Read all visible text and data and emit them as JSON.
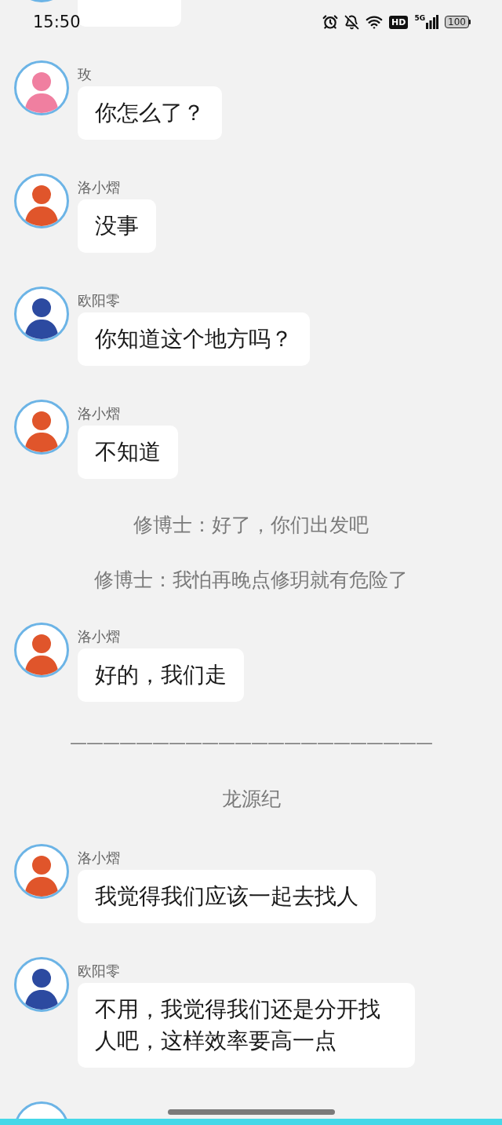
{
  "status_bar": {
    "time": "15:50",
    "hd": "HD",
    "network": "5G",
    "battery": "100"
  },
  "messages": [
    {
      "kind": "fragment"
    },
    {
      "kind": "message",
      "name": "玫",
      "color": "#f07fa0",
      "text": "你怎么了？"
    },
    {
      "kind": "message",
      "name": "洛小熠",
      "color": "#e0552b",
      "text": "没事"
    },
    {
      "kind": "message",
      "name": "欧阳零",
      "color": "#2c4aa0",
      "text": "你知道这个地方吗？"
    },
    {
      "kind": "message",
      "name": "洛小熠",
      "color": "#e0552b",
      "text": "不知道"
    },
    {
      "kind": "narration",
      "text": "修博士：好了，你们出发吧"
    },
    {
      "kind": "narration",
      "text": "修博士：我怕再晚点修玥就有危险了"
    },
    {
      "kind": "message",
      "name": "洛小熠",
      "color": "#e0552b",
      "text": "好的，我们走"
    },
    {
      "kind": "divider",
      "text": "——————————————————————"
    },
    {
      "kind": "chapter",
      "text": "龙源纪"
    },
    {
      "kind": "message",
      "name": "洛小熠",
      "color": "#e0552b",
      "text": "我觉得我们应该一起去找人"
    },
    {
      "kind": "message",
      "name": "欧阳零",
      "color": "#2c4aa0",
      "text": "不用，我觉得我们还是分开找人吧，这样效率要高一点"
    },
    {
      "kind": "message"
    }
  ]
}
